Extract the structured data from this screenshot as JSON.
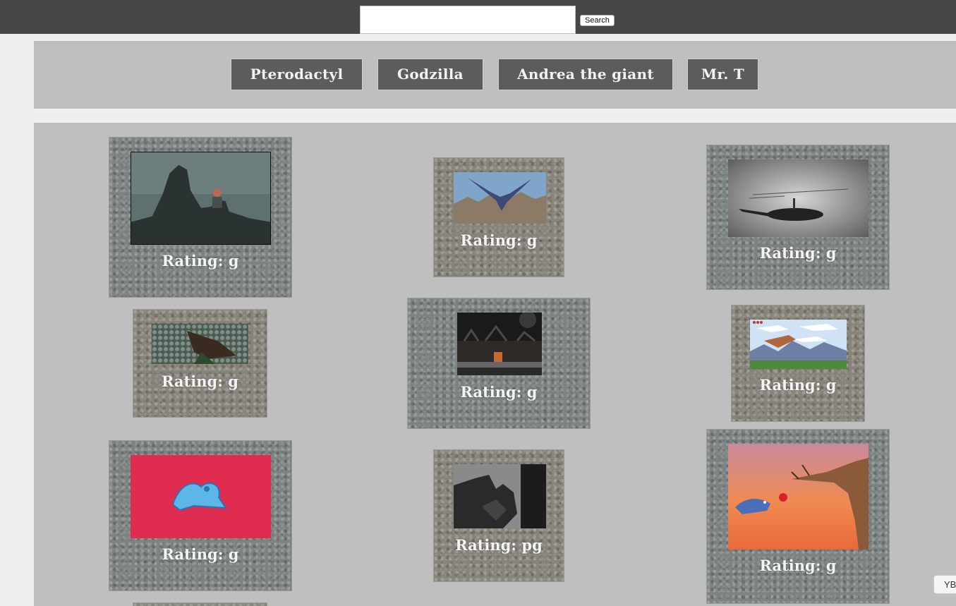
{
  "search": {
    "placeholder": "",
    "value": "",
    "button_label": "Search"
  },
  "topics": [
    "Pterodactyl",
    "Godzilla",
    "Andrea the giant",
    "Mr. T"
  ],
  "gifs": [
    {
      "rating": "Rating: g"
    },
    {
      "rating": "Rating: g"
    },
    {
      "rating": "Rating: g"
    },
    {
      "rating": "Rating: g"
    },
    {
      "rating": "Rating: g"
    },
    {
      "rating": "Rating: g"
    },
    {
      "rating": "Rating: g"
    },
    {
      "rating": "Rating: pg"
    },
    {
      "rating": "Rating: g"
    }
  ],
  "corner_tab": {
    "label": "YB"
  },
  "colors": {
    "top_bar": "#464646",
    "panel": "#bfbfbf",
    "topic_button": "#5c5c5c",
    "page": "#efefef"
  }
}
